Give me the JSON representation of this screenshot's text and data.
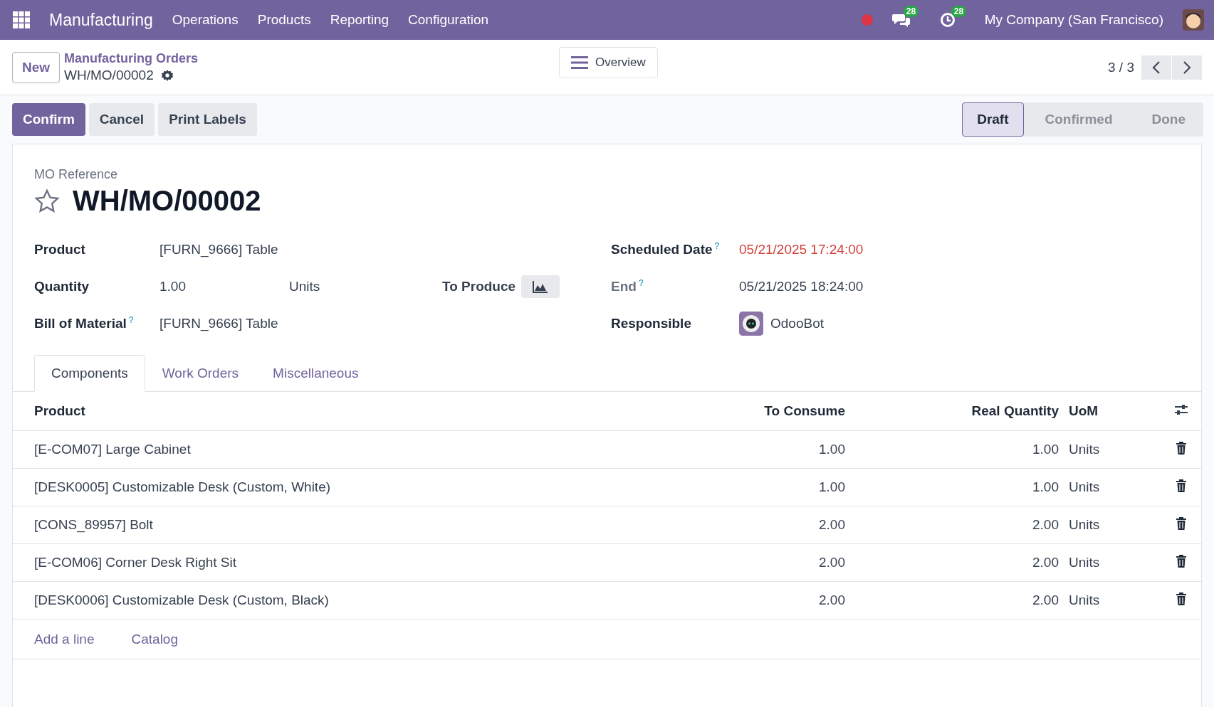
{
  "navbar": {
    "app_name": "Manufacturing",
    "menu": [
      "Operations",
      "Products",
      "Reporting",
      "Configuration"
    ],
    "messages_count": "28",
    "activities_count": "28",
    "company": "My Company (San Francisco)"
  },
  "control_panel": {
    "new_button": "New",
    "breadcrumb": "Manufacturing Orders",
    "record": "WH/MO/00002",
    "overview_button": "Overview",
    "pager": "3 / 3"
  },
  "actions": [
    {
      "label": "Confirm",
      "kind": "primary"
    },
    {
      "label": "Cancel",
      "kind": "secondary"
    },
    {
      "label": "Print Labels",
      "kind": "secondary"
    }
  ],
  "status_steps": [
    {
      "label": "Draft",
      "selected": true
    },
    {
      "label": "Confirmed",
      "selected": false
    },
    {
      "label": "Done",
      "selected": false
    }
  ],
  "form": {
    "reference_label": "MO Reference",
    "reference": "WH/MO/00002",
    "starred": false,
    "left_fields": [
      {
        "label": "Product",
        "value": "[FURN_9666] Table"
      },
      {
        "label": "Quantity",
        "value": "1.00",
        "unit": "Units",
        "to_produce_label": "To Produce"
      },
      {
        "label": "Bill of Material",
        "value": "[FURN_9666] Table",
        "help": "?"
      }
    ],
    "scheduled_date": {
      "label": "Scheduled Date",
      "help": "?",
      "value": "05/21/2025 17:24:00",
      "late": true
    },
    "end": {
      "label": "End",
      "help": "?",
      "value": "05/21/2025 18:24:00"
    },
    "responsible": {
      "label": "Responsible",
      "value": "OdooBot"
    }
  },
  "tabs": [
    {
      "label": "Components",
      "selected": true
    },
    {
      "label": "Work Orders",
      "selected": false
    },
    {
      "label": "Miscellaneous",
      "selected": false
    }
  ],
  "table": {
    "columns": [
      "Product",
      "To Consume",
      "Real Quantity",
      "UoM"
    ],
    "rows": [
      {
        "product": "[E-COM07] Large Cabinet",
        "to_consume": "1.00",
        "real_quantity": "1.00",
        "uom": "Units"
      },
      {
        "product": "[DESK0005] Customizable Desk (Custom, White)",
        "to_consume": "1.00",
        "real_quantity": "1.00",
        "uom": "Units"
      },
      {
        "product": "[CONS_89957] Bolt",
        "to_consume": "2.00",
        "real_quantity": "2.00",
        "uom": "Units"
      },
      {
        "product": "[E-COM06] Corner Desk Right Sit",
        "to_consume": "2.00",
        "real_quantity": "2.00",
        "uom": "Units"
      },
      {
        "product": "[DESK0006] Customizable Desk (Custom, Black)",
        "to_consume": "2.00",
        "real_quantity": "2.00",
        "uom": "Units"
      }
    ],
    "links": [
      "Add a line",
      "Catalog"
    ]
  }
}
